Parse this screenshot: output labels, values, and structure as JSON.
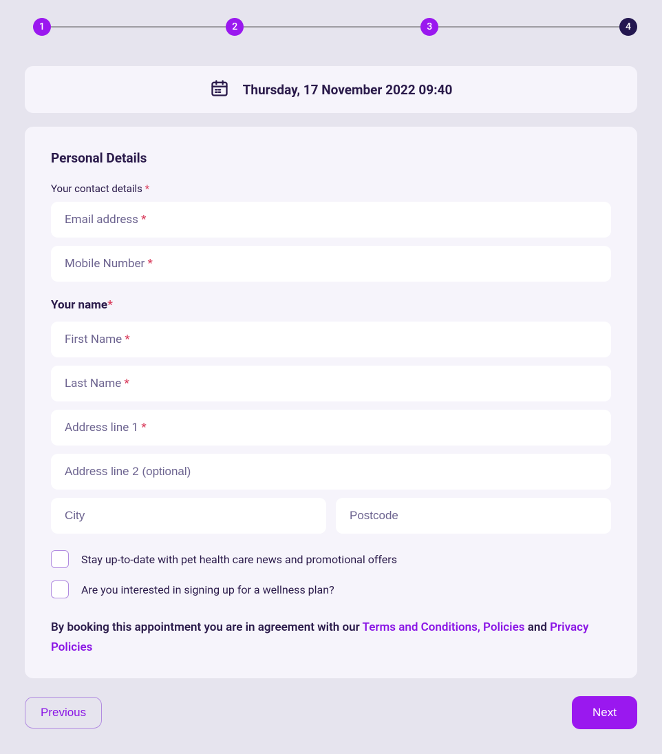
{
  "stepper": {
    "steps": [
      "1",
      "2",
      "3",
      "4"
    ],
    "current": 4
  },
  "date_banner": {
    "text": "Thursday, 17 November 2022 09:40"
  },
  "form": {
    "section_title": "Personal Details",
    "contact_label": "Your contact details ",
    "email_ph": "Email address ",
    "mobile_ph": "Mobile Number ",
    "name_label": "Your name",
    "first_name_ph": "First Name ",
    "last_name_ph": "Last Name ",
    "addr1_ph": "Address line 1 ",
    "addr2_ph": "Address line 2 (optional)",
    "city_ph": "City",
    "postcode_ph": "Postcode",
    "asterisk": "*",
    "checkbox1": "Stay up-to-date with pet health care news and promotional offers",
    "checkbox2": "Are you interested in signing up for a wellness plan?",
    "agreement_prefix": "By booking this appointment you are in agreement with our ",
    "terms_link": "Terms and Conditions, Policies",
    "agreement_mid": " and ",
    "privacy_link": "Privacy Policies"
  },
  "footer": {
    "prev": "Previous",
    "next": "Next"
  }
}
